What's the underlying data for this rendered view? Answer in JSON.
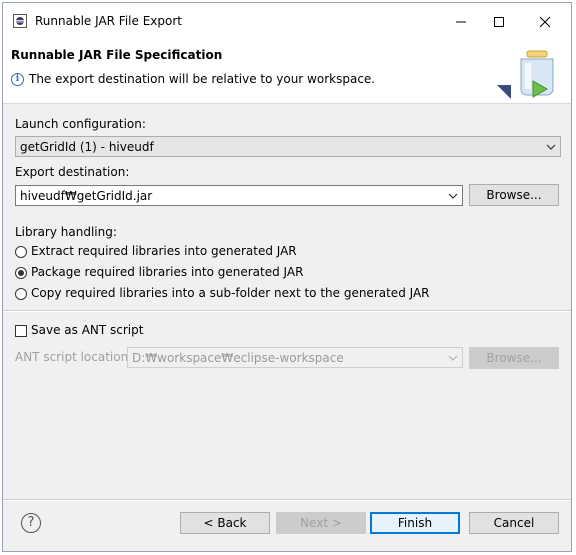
{
  "window": {
    "title": "Runnable JAR File Export",
    "controls": {
      "minimize": "minimize-icon",
      "maximize": "maximize-icon",
      "close": "close-icon"
    }
  },
  "header": {
    "title": "Runnable JAR File Specification",
    "message": "The export destination will be relative to your workspace."
  },
  "launch": {
    "label": "Launch configuration:",
    "value": "getGridId (1) - hiveudf"
  },
  "export": {
    "label": "Export destination:",
    "value": "hiveudf₩getGridId.jar",
    "browse": "Browse..."
  },
  "library": {
    "label": "Library handling:",
    "options": [
      {
        "label": "Extract required libraries into generated JAR",
        "selected": false
      },
      {
        "label": "Package required libraries into generated JAR",
        "selected": true
      },
      {
        "label": "Copy required libraries into a sub-folder next to the generated JAR",
        "selected": false
      }
    ]
  },
  "ant": {
    "checkbox_label": "Save as ANT script",
    "checked": false,
    "location_label": "ANT script location:",
    "location_value": "D:₩workspace₩eclipse-workspace",
    "browse": "Browse..."
  },
  "footer": {
    "back": "< Back",
    "next": "Next >",
    "finish": "Finish",
    "cancel": "Cancel"
  },
  "colors": {
    "accent": "#0078d7",
    "info": "#2f6dc2"
  }
}
